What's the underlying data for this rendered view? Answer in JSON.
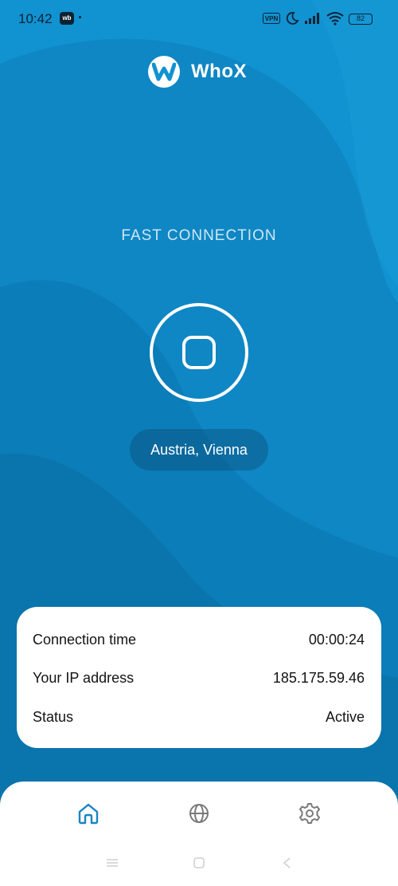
{
  "status_bar": {
    "time": "10:42",
    "app_badge": "wb",
    "vpn_badge": "VPN",
    "battery": "82"
  },
  "header": {
    "app_name": "WhoX",
    "logo_icon": "whox-logo-icon"
  },
  "main": {
    "mode_label": "FAST CONNECTION",
    "power_button_icon": "stop-icon",
    "location": "Austria, Vienna"
  },
  "info": {
    "rows": [
      {
        "label": "Connection time",
        "value": "00:00:24"
      },
      {
        "label": "Your IP address",
        "value": "185.175.59.46"
      },
      {
        "label": "Status",
        "value": "Active"
      }
    ]
  },
  "nav": {
    "items": [
      "home-icon",
      "globe-icon",
      "settings-icon"
    ],
    "active_color": "#1a84c4",
    "inactive_color": "#7a7a7a"
  },
  "colors": {
    "background": "#0f88c6",
    "card": "#ffffff"
  }
}
